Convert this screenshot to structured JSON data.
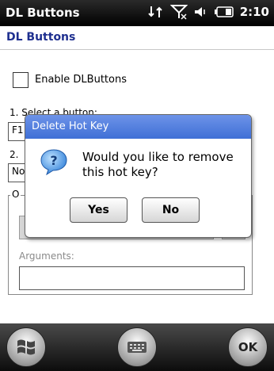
{
  "status": {
    "title": "DL Buttons",
    "time": "2:10"
  },
  "header": {
    "title": "DL Buttons"
  },
  "form": {
    "enable_label": "Enable DLButtons",
    "step1_label": "1. Select a button:",
    "button_value": "F1",
    "step2_label": "2.",
    "action_value": "No",
    "group_label": "O",
    "arguments_label": "Arguments:",
    "arguments_value": ""
  },
  "dialog": {
    "title": "Delete Hot Key",
    "message": "Would you like to remove this hot key?",
    "yes_label": "Yes",
    "no_label": "No"
  },
  "bottom": {
    "ok_label": "OK"
  },
  "colors": {
    "header_text": "#1e2f8f",
    "dialog_title_bg": "#4f7ddc"
  }
}
